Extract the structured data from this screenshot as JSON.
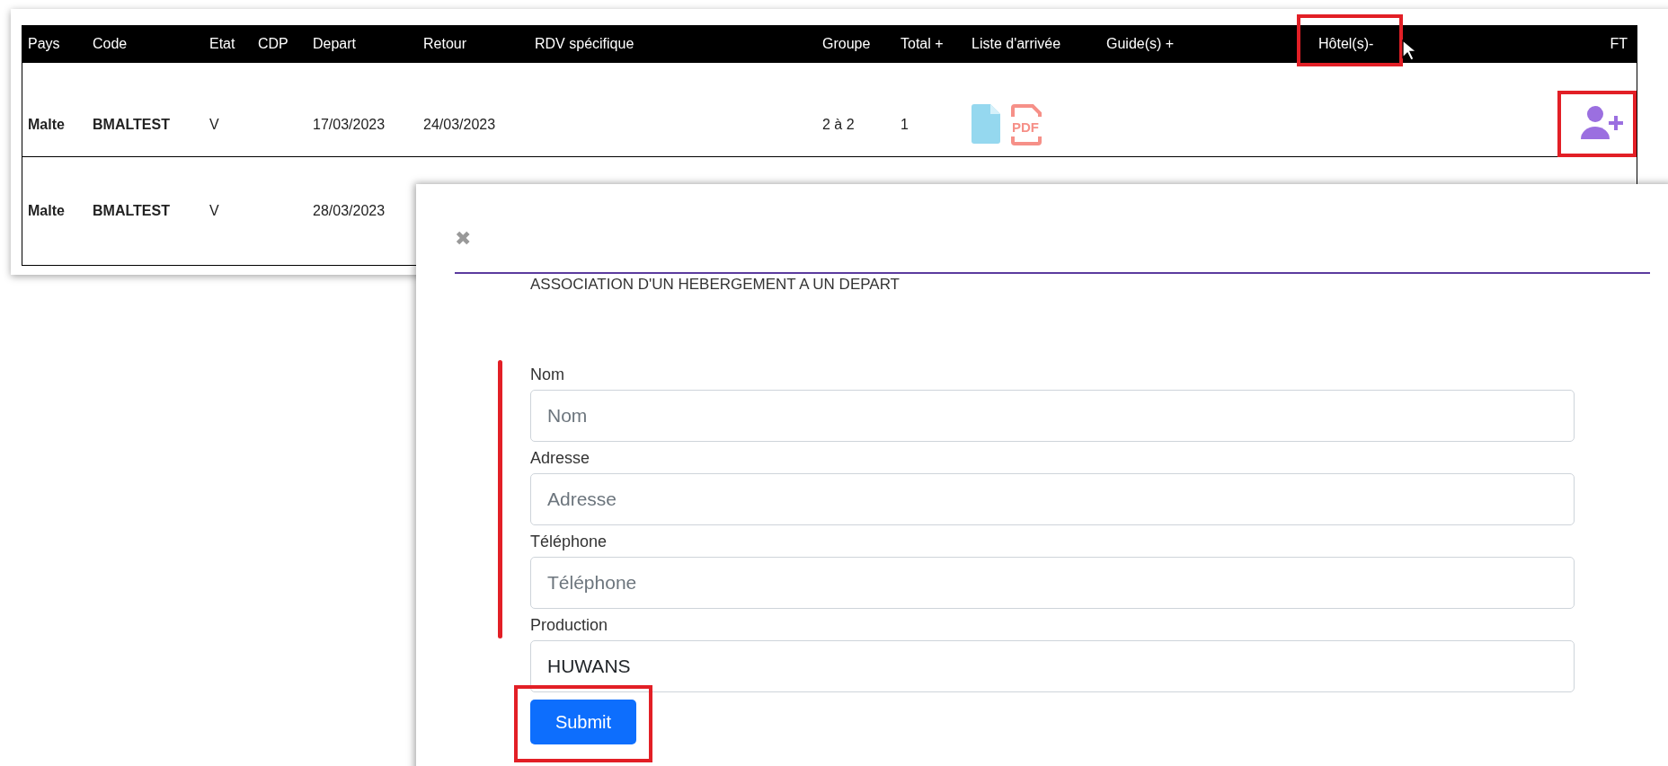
{
  "table": {
    "columns": [
      {
        "label": "Pays",
        "highlighted": false
      },
      {
        "label": "Code",
        "highlighted": false
      },
      {
        "label": "Etat",
        "highlighted": false
      },
      {
        "label": "CDP",
        "highlighted": false
      },
      {
        "label": "Depart",
        "highlighted": false
      },
      {
        "label": "Retour",
        "highlighted": false
      },
      {
        "label": "RDV spécifique",
        "highlighted": false
      },
      {
        "label": "Groupe",
        "highlighted": false
      },
      {
        "label": "Total +",
        "highlighted": false
      },
      {
        "label": "Liste d'arrivée",
        "highlighted": false
      },
      {
        "label": "Guide(s) +",
        "highlighted": false
      },
      {
        "label": "Hôtel(s)-",
        "highlighted": true
      },
      {
        "label": "FT",
        "highlighted": false
      }
    ],
    "rows": [
      {
        "cells": [
          "Malte",
          "BMALTEST",
          "V",
          "",
          "17/03/2023",
          "24/03/2023",
          "",
          "2 à 2",
          "1"
        ],
        "documents": true,
        "pdf_label": "PDF",
        "add_person": true,
        "add_person_highlighted": true
      },
      {
        "cells": [
          "Malte",
          "BMALTEST",
          "V",
          "",
          "28/03/2023"
        ]
      }
    ]
  },
  "modal": {
    "close": "✖",
    "title": "ASSOCIATION D'UN HEBERGEMENT A UN DEPART",
    "fields": [
      {
        "label": "Nom",
        "placeholder": "Nom"
      },
      {
        "label": "Adresse",
        "placeholder": "Adresse"
      },
      {
        "label": "Téléphone",
        "placeholder": "Téléphone"
      },
      {
        "label": "Production",
        "value": "HUWANS"
      }
    ],
    "submit": {
      "label": "Submit",
      "highlighted": true
    }
  }
}
